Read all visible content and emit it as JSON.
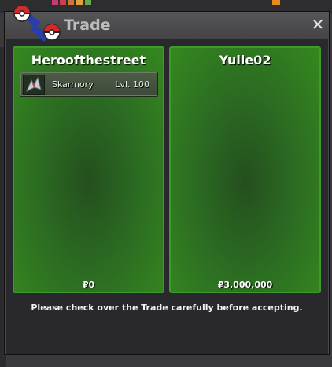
{
  "window": {
    "title": "Trade",
    "close_label": "✕"
  },
  "trade": {
    "left": {
      "player": "Heroofthestreet",
      "money": "₽0",
      "pokemon": [
        {
          "name": "Skarmory",
          "level": "Lvl. 100",
          "icon": "skarmory-sprite"
        }
      ]
    },
    "right": {
      "player": "Yuiie02",
      "money": "₽3,000,000",
      "pokemon": []
    }
  },
  "notice": "Please check over the Trade carefully before accepting.",
  "colors": {
    "panel_green": "#2b6a22",
    "panel_border": "#3e9a2c",
    "window_bg": "#29292d",
    "titlebar": "#4d4d50"
  }
}
